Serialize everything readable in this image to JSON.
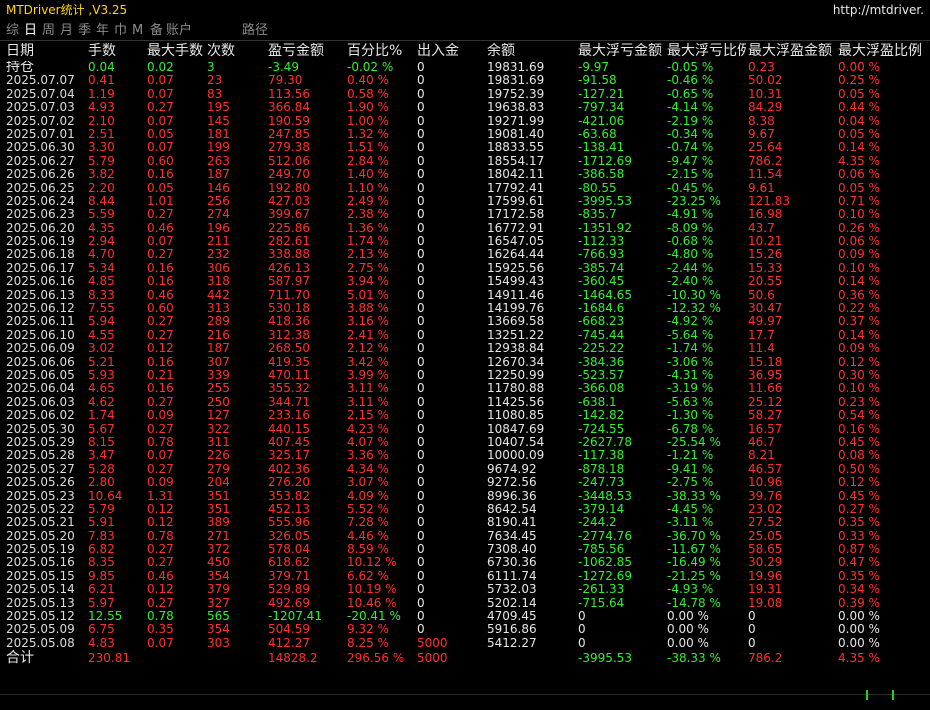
{
  "window": {
    "title": "MTDriver统计 ,V3.25",
    "url": "http://mtdriver."
  },
  "tabs": [
    {
      "label": "综",
      "active": false
    },
    {
      "label": "日",
      "active": true
    },
    {
      "label": "周",
      "active": false
    },
    {
      "label": "月",
      "active": false
    },
    {
      "label": "季",
      "active": false
    },
    {
      "label": "年",
      "active": false
    },
    {
      "label": "巾",
      "active": false
    },
    {
      "label": "M",
      "active": false
    },
    {
      "label": "备",
      "active": false
    },
    {
      "label": "账户",
      "active": false
    },
    {
      "label": "路径",
      "active": false
    }
  ],
  "columns": [
    "日期",
    "手数",
    "最大手数",
    "次数",
    "盈亏金额",
    "百分比%",
    "出入金",
    "余额",
    "最大浮亏金额",
    "最大浮亏比例",
    "最大浮盈金额",
    "最大浮盈比例"
  ],
  "holding": [
    "持仓",
    "0.04",
    "0.02",
    "3",
    "-3.49",
    "-0.02 %",
    "0",
    "19831.69",
    "-9.97",
    "-0.05 %",
    "0.23",
    "0.00 %"
  ],
  "rows": [
    [
      "2025.07.07",
      "0.41",
      "0.07",
      "23",
      "79.30",
      "0.40 %",
      "0",
      "19831.69",
      "-91.58",
      "-0.46 %",
      "50.02",
      "0.25 %"
    ],
    [
      "2025.07.04",
      "1.19",
      "0.07",
      "83",
      "113.56",
      "0.58 %",
      "0",
      "19752.39",
      "-127.21",
      "-0.65 %",
      "10.31",
      "0.05 %"
    ],
    [
      "2025.07.03",
      "4.93",
      "0.27",
      "195",
      "366.84",
      "1.90 %",
      "0",
      "19638.83",
      "-797.34",
      "-4.14 %",
      "84.29",
      "0.44 %"
    ],
    [
      "2025.07.02",
      "2.10",
      "0.07",
      "145",
      "190.59",
      "1.00 %",
      "0",
      "19271.99",
      "-421.06",
      "-2.19 %",
      "8.38",
      "0.04 %"
    ],
    [
      "2025.07.01",
      "2.51",
      "0.05",
      "181",
      "247.85",
      "1.32 %",
      "0",
      "19081.40",
      "-63.68",
      "-0.34 %",
      "9.67",
      "0.05 %"
    ],
    [
      "2025.06.30",
      "3.30",
      "0.07",
      "199",
      "279.38",
      "1.51 %",
      "0",
      "18833.55",
      "-138.41",
      "-0.74 %",
      "25.64",
      "0.14 %"
    ],
    [
      "2025.06.27",
      "5.79",
      "0.60",
      "263",
      "512.06",
      "2.84 %",
      "0",
      "18554.17",
      "-1712.69",
      "-9.47 %",
      "786.2",
      "4.35 %"
    ],
    [
      "2025.06.26",
      "3.82",
      "0.16",
      "187",
      "249.70",
      "1.40 %",
      "0",
      "18042.11",
      "-386.58",
      "-2.15 %",
      "11.54",
      "0.06 %"
    ],
    [
      "2025.06.25",
      "2.20",
      "0.05",
      "146",
      "192.80",
      "1.10 %",
      "0",
      "17792.41",
      "-80.55",
      "-0.45 %",
      "9.61",
      "0.05 %"
    ],
    [
      "2025.06.24",
      "8.44",
      "1.01",
      "256",
      "427.03",
      "2.49 %",
      "0",
      "17599.61",
      "-3995.53",
      "-23.25 %",
      "121.83",
      "0.71 %"
    ],
    [
      "2025.06.23",
      "5.59",
      "0.27",
      "274",
      "399.67",
      "2.38 %",
      "0",
      "17172.58",
      "-835.7",
      "-4.91 %",
      "16.98",
      "0.10 %"
    ],
    [
      "2025.06.20",
      "4.35",
      "0.46",
      "196",
      "225.86",
      "1.36 %",
      "0",
      "16772.91",
      "-1351.92",
      "-8.09 %",
      "43.7",
      "0.26 %"
    ],
    [
      "2025.06.19",
      "2.94",
      "0.07",
      "211",
      "282.61",
      "1.74 %",
      "0",
      "16547.05",
      "-112.33",
      "-0.68 %",
      "10.21",
      "0.06 %"
    ],
    [
      "2025.06.18",
      "4.70",
      "0.27",
      "232",
      "338.88",
      "2.13 %",
      "0",
      "16264.44",
      "-766.93",
      "-4.80 %",
      "15.26",
      "0.09 %"
    ],
    [
      "2025.06.17",
      "5.34",
      "0.16",
      "306",
      "426.13",
      "2.75 %",
      "0",
      "15925.56",
      "-385.74",
      "-2.44 %",
      "15.33",
      "0.10 %"
    ],
    [
      "2025.06.16",
      "4.85",
      "0.16",
      "318",
      "587.97",
      "3.94 %",
      "0",
      "15499.43",
      "-360.45",
      "-2.40 %",
      "20.55",
      "0.14 %"
    ],
    [
      "2025.06.13",
      "8.33",
      "0.46",
      "442",
      "711.70",
      "5.01 %",
      "0",
      "14911.46",
      "-1464.65",
      "-10.30 %",
      "50.6",
      "0.36 %"
    ],
    [
      "2025.06.12",
      "7.55",
      "0.60",
      "313",
      "530.18",
      "3.88 %",
      "0",
      "14199.76",
      "-1684.6",
      "-12.32 %",
      "30.47",
      "0.22 %"
    ],
    [
      "2025.06.11",
      "5.94",
      "0.27",
      "289",
      "418.36",
      "3.16 %",
      "0",
      "13669.58",
      "-668.23",
      "-4.92 %",
      "49.97",
      "0.37 %"
    ],
    [
      "2025.06.10",
      "4.55",
      "0.27",
      "216",
      "312.38",
      "2.41 %",
      "0",
      "13251.22",
      "-745.44",
      "-5.64 %",
      "17.7",
      "0.14 %"
    ],
    [
      "2025.06.09",
      "3.02",
      "0.12",
      "187",
      "268.50",
      "2.12 %",
      "0",
      "12938.84",
      "-225.22",
      "-1.74 %",
      "11.4",
      "0.09 %"
    ],
    [
      "2025.06.06",
      "5.21",
      "0.16",
      "307",
      "419.35",
      "3.42 %",
      "0",
      "12670.34",
      "-384.36",
      "-3.06 %",
      "15.18",
      "0.12 %"
    ],
    [
      "2025.06.05",
      "5.93",
      "0.21",
      "339",
      "470.11",
      "3.99 %",
      "0",
      "12250.99",
      "-523.57",
      "-4.31 %",
      "36.95",
      "0.30 %"
    ],
    [
      "2025.06.04",
      "4.65",
      "0.16",
      "255",
      "355.32",
      "3.11 %",
      "0",
      "11780.88",
      "-366.08",
      "-3.19 %",
      "11.66",
      "0.10 %"
    ],
    [
      "2025.06.03",
      "4.62",
      "0.27",
      "250",
      "344.71",
      "3.11 %",
      "0",
      "11425.56",
      "-638.1",
      "-5.63 %",
      "25.12",
      "0.23 %"
    ],
    [
      "2025.06.02",
      "1.74",
      "0.09",
      "127",
      "233.16",
      "2.15 %",
      "0",
      "11080.85",
      "-142.82",
      "-1.30 %",
      "58.27",
      "0.54 %"
    ],
    [
      "2025.05.30",
      "5.67",
      "0.27",
      "322",
      "440.15",
      "4.23 %",
      "0",
      "10847.69",
      "-724.55",
      "-6.78 %",
      "16.57",
      "0.16 %"
    ],
    [
      "2025.05.29",
      "8.15",
      "0.78",
      "311",
      "407.45",
      "4.07 %",
      "0",
      "10407.54",
      "-2627.78",
      "-25.54 %",
      "46.7",
      "0.45 %"
    ],
    [
      "2025.05.28",
      "3.47",
      "0.07",
      "226",
      "325.17",
      "3.36 %",
      "0",
      "10000.09",
      "-117.38",
      "-1.21 %",
      "8.21",
      "0.08 %"
    ],
    [
      "2025.05.27",
      "5.28",
      "0.27",
      "279",
      "402.36",
      "4.34 %",
      "0",
      "9674.92",
      "-878.18",
      "-9.41 %",
      "46.57",
      "0.50 %"
    ],
    [
      "2025.05.26",
      "2.80",
      "0.09",
      "204",
      "276.20",
      "3.07 %",
      "0",
      "9272.56",
      "-247.73",
      "-2.75 %",
      "10.96",
      "0.12 %"
    ],
    [
      "2025.05.23",
      "10.64",
      "1.31",
      "351",
      "353.82",
      "4.09 %",
      "0",
      "8996.36",
      "-3448.53",
      "-38.33 %",
      "39.76",
      "0.45 %"
    ],
    [
      "2025.05.22",
      "5.79",
      "0.12",
      "351",
      "452.13",
      "5.52 %",
      "0",
      "8642.54",
      "-379.14",
      "-4.45 %",
      "23.02",
      "0.27 %"
    ],
    [
      "2025.05.21",
      "5.91",
      "0.12",
      "389",
      "555.96",
      "7.28 %",
      "0",
      "8190.41",
      "-244.2",
      "-3.11 %",
      "27.52",
      "0.35 %"
    ],
    [
      "2025.05.20",
      "7.83",
      "0.78",
      "271",
      "326.05",
      "4.46 %",
      "0",
      "7634.45",
      "-2774.76",
      "-36.70 %",
      "25.05",
      "0.33 %"
    ],
    [
      "2025.05.19",
      "6.82",
      "0.27",
      "372",
      "578.04",
      "8.59 %",
      "0",
      "7308.40",
      "-785.56",
      "-11.67 %",
      "58.65",
      "0.87 %"
    ],
    [
      "2025.05.16",
      "8.35",
      "0.27",
      "450",
      "618.62",
      "10.12 %",
      "0",
      "6730.36",
      "-1062.85",
      "-16.49 %",
      "30.29",
      "0.47 %"
    ],
    [
      "2025.05.15",
      "9.85",
      "0.46",
      "354",
      "379.71",
      "6.62 %",
      "0",
      "6111.74",
      "-1272.69",
      "-21.25 %",
      "19.96",
      "0.35 %"
    ],
    [
      "2025.05.14",
      "6.21",
      "0.12",
      "379",
      "529.89",
      "10.19 %",
      "0",
      "5732.03",
      "-261.33",
      "-4.93 %",
      "19.31",
      "0.34 %"
    ],
    [
      "2025.05.13",
      "5.97",
      "0.27",
      "327",
      "492.69",
      "10.46 %",
      "0",
      "5202.14",
      "-715.64",
      "-14.78 %",
      "19.08",
      "0.39 %"
    ],
    [
      "2025.05.12",
      "12.55",
      "0.78",
      "565",
      "-1207.41",
      "-20.41 %",
      "0",
      "4709.45",
      "0",
      "0.00 %",
      "0",
      "0.00 %"
    ],
    [
      "2025.05.09",
      "6.75",
      "0.35",
      "354",
      "504.59",
      "9.32 %",
      "0",
      "5916.86",
      "0",
      "0.00 %",
      "0",
      "0.00 %"
    ],
    [
      "2025.05.08",
      "4.83",
      "0.07",
      "303",
      "412.27",
      "8.25 %",
      "5000",
      "5412.27",
      "0",
      "0.00 %",
      "0",
      "0.00 %"
    ]
  ],
  "totals": [
    "合计",
    "230.81",
    "",
    "",
    "14828.2",
    "296.56 %",
    "5000",
    "",
    "-3995.53",
    "-38.33 %",
    "786.2",
    "4.35 %"
  ],
  "colors": {
    "background": "#000000",
    "title": "#ffd700",
    "profit": "#ff3030",
    "loss": "#33ee33",
    "neutral": "#e6e6e6"
  }
}
